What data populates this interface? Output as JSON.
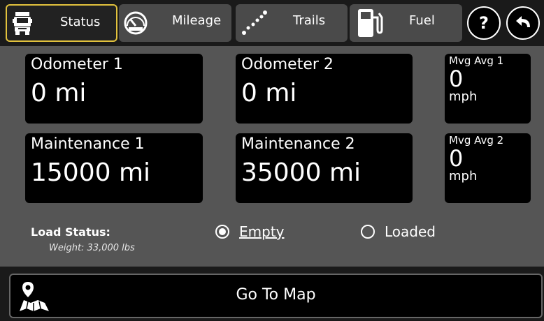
{
  "tabs": [
    {
      "label": "Status",
      "icon": "truck-icon",
      "active": true
    },
    {
      "label": "Mileage",
      "icon": "speedometer-icon",
      "active": false
    },
    {
      "label": "Trails",
      "icon": "trail-dots-icon",
      "active": false
    },
    {
      "label": "Fuel",
      "icon": "fuel-pump-icon",
      "active": false
    }
  ],
  "header_buttons": {
    "help": "?",
    "back_icon": "back-arrow-icon"
  },
  "odometers": [
    {
      "label": "Odometer 1",
      "value": "0 mi"
    },
    {
      "label": "Odometer 2",
      "value": "0 mi"
    }
  ],
  "maintenance": [
    {
      "label": "Maintenance 1",
      "value": "15000 mi"
    },
    {
      "label": "Maintenance 2",
      "value": "35000 mi"
    }
  ],
  "moving_averages": [
    {
      "label": "Mvg Avg 1",
      "value": "0",
      "unit": "mph"
    },
    {
      "label": "Mvg Avg 2",
      "value": "0",
      "unit": "mph"
    }
  ],
  "load_status": {
    "title": "Load Status:",
    "weight": "Weight: 33,000 lbs",
    "options": [
      {
        "label": "Empty",
        "selected": true
      },
      {
        "label": "Loaded",
        "selected": false
      }
    ]
  },
  "map_button": {
    "label": "Go To Map",
    "icon": "map-pin-icon"
  },
  "colors": {
    "active_tab_border": "#e2c23d",
    "background": "#555555",
    "card": "#000000"
  }
}
